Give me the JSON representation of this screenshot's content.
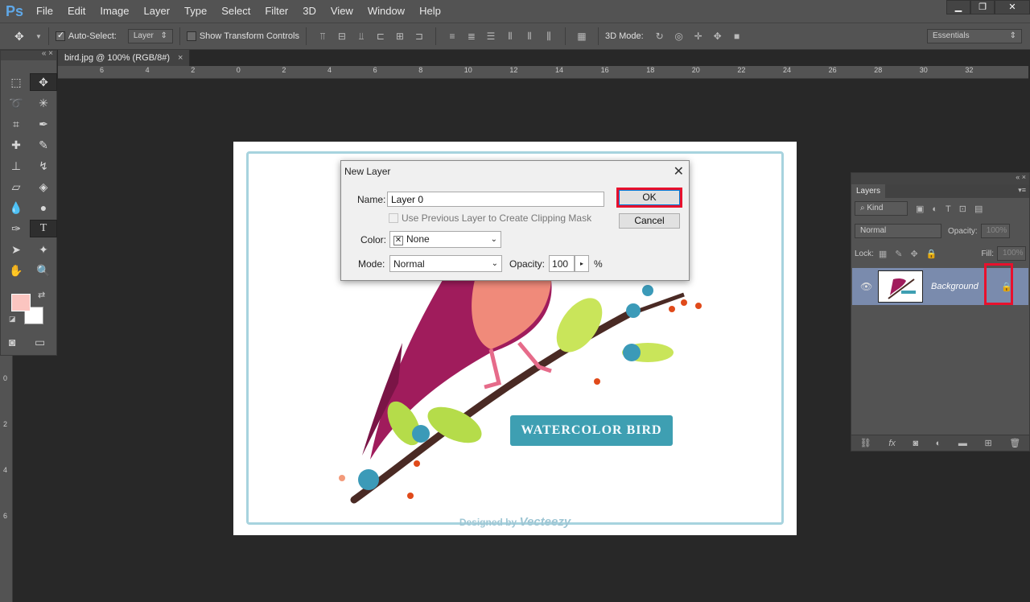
{
  "app": {
    "logo": "Ps"
  },
  "menu": [
    "File",
    "Edit",
    "Image",
    "Layer",
    "Type",
    "Select",
    "Filter",
    "3D",
    "View",
    "Window",
    "Help"
  ],
  "window_controls": {
    "minimize": "▁",
    "restore": "❐",
    "close": "✕"
  },
  "options": {
    "auto_select_label": "Auto-Select:",
    "auto_select_value": "Layer",
    "show_transform_label": "Show Transform Controls",
    "mode_3d_label": "3D Mode:",
    "workspace": "Essentials"
  },
  "document_tab": {
    "title": "bird.jpg @ 100% (RGB/8#)",
    "close": "×"
  },
  "ruler_h": [
    "6",
    "4",
    "2",
    "0",
    "2",
    "4",
    "6",
    "8",
    "10",
    "12",
    "14",
    "16",
    "18",
    "20",
    "22",
    "24",
    "26",
    "28",
    "30",
    "32"
  ],
  "ruler_v": [
    "0",
    "2",
    "4",
    "6"
  ],
  "canvas": {
    "banner_text": "WATERCOLOR BIRD",
    "designed_by": "Designed by",
    "brand": "Vecteezy"
  },
  "dialog": {
    "title": "New Layer",
    "name_label": "Name:",
    "name_value": "Layer 0",
    "clipping_label": "Use Previous Layer to Create Clipping Mask",
    "color_label": "Color:",
    "color_value": "None",
    "mode_label": "Mode:",
    "mode_value": "Normal",
    "opacity_label": "Opacity:",
    "opacity_value": "100",
    "opacity_unit": "%",
    "ok_label": "OK",
    "cancel_label": "Cancel"
  },
  "layers_panel": {
    "tab_label": "Layers",
    "filter_kind": "Kind",
    "blend_mode": "Normal",
    "opacity_label": "Opacity:",
    "opacity_value": "100%",
    "lock_label": "Lock:",
    "fill_label": "Fill:",
    "fill_value": "100%",
    "layer_name": "Background"
  },
  "colors": {
    "foreground": "#fbc5c0",
    "background": "#ffffff",
    "highlight": "#e8112d",
    "selected_layer": "#7a8bad"
  }
}
